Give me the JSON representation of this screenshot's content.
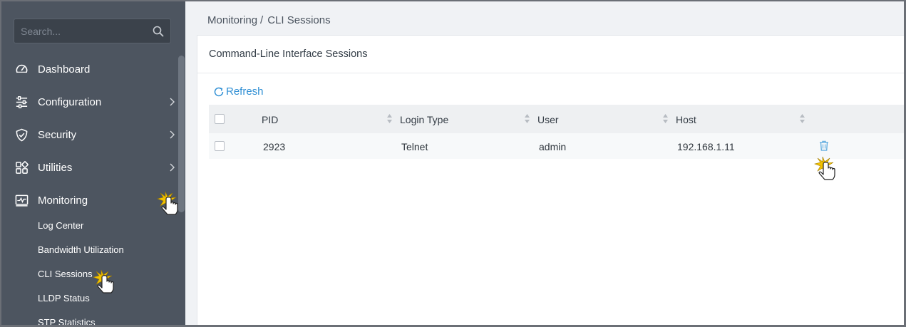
{
  "search": {
    "placeholder": "Search..."
  },
  "sidebar": {
    "items": [
      {
        "label": "Dashboard",
        "icon": "gauge-icon"
      },
      {
        "label": "Configuration",
        "icon": "sliders-icon"
      },
      {
        "label": "Security",
        "icon": "shield-icon"
      },
      {
        "label": "Utilities",
        "icon": "grid-icon"
      },
      {
        "label": "Monitoring",
        "icon": "monitor-chart-icon"
      }
    ],
    "subitems": [
      "Log Center",
      "Bandwidth Utilization",
      "CLI Sessions",
      "LLDP Status",
      "STP Statistics"
    ]
  },
  "breadcrumb": {
    "parent": "Monitoring",
    "separator": "/",
    "current": "CLI Sessions"
  },
  "panel": {
    "title": "Command-Line Interface Sessions"
  },
  "toolbar": {
    "refresh_label": "Refresh"
  },
  "table": {
    "columns": [
      "PID",
      "Login Type",
      "User",
      "Host"
    ],
    "rows": [
      {
        "pid": "2923",
        "login_type": "Telnet",
        "user": "admin",
        "host": "192.168.1.11"
      }
    ]
  },
  "colors": {
    "sidebar_bg": "#4d5560",
    "accent": "#2f8fd4",
    "header_bg": "#eef0f2",
    "cursor_highlight": "#f2c200"
  }
}
